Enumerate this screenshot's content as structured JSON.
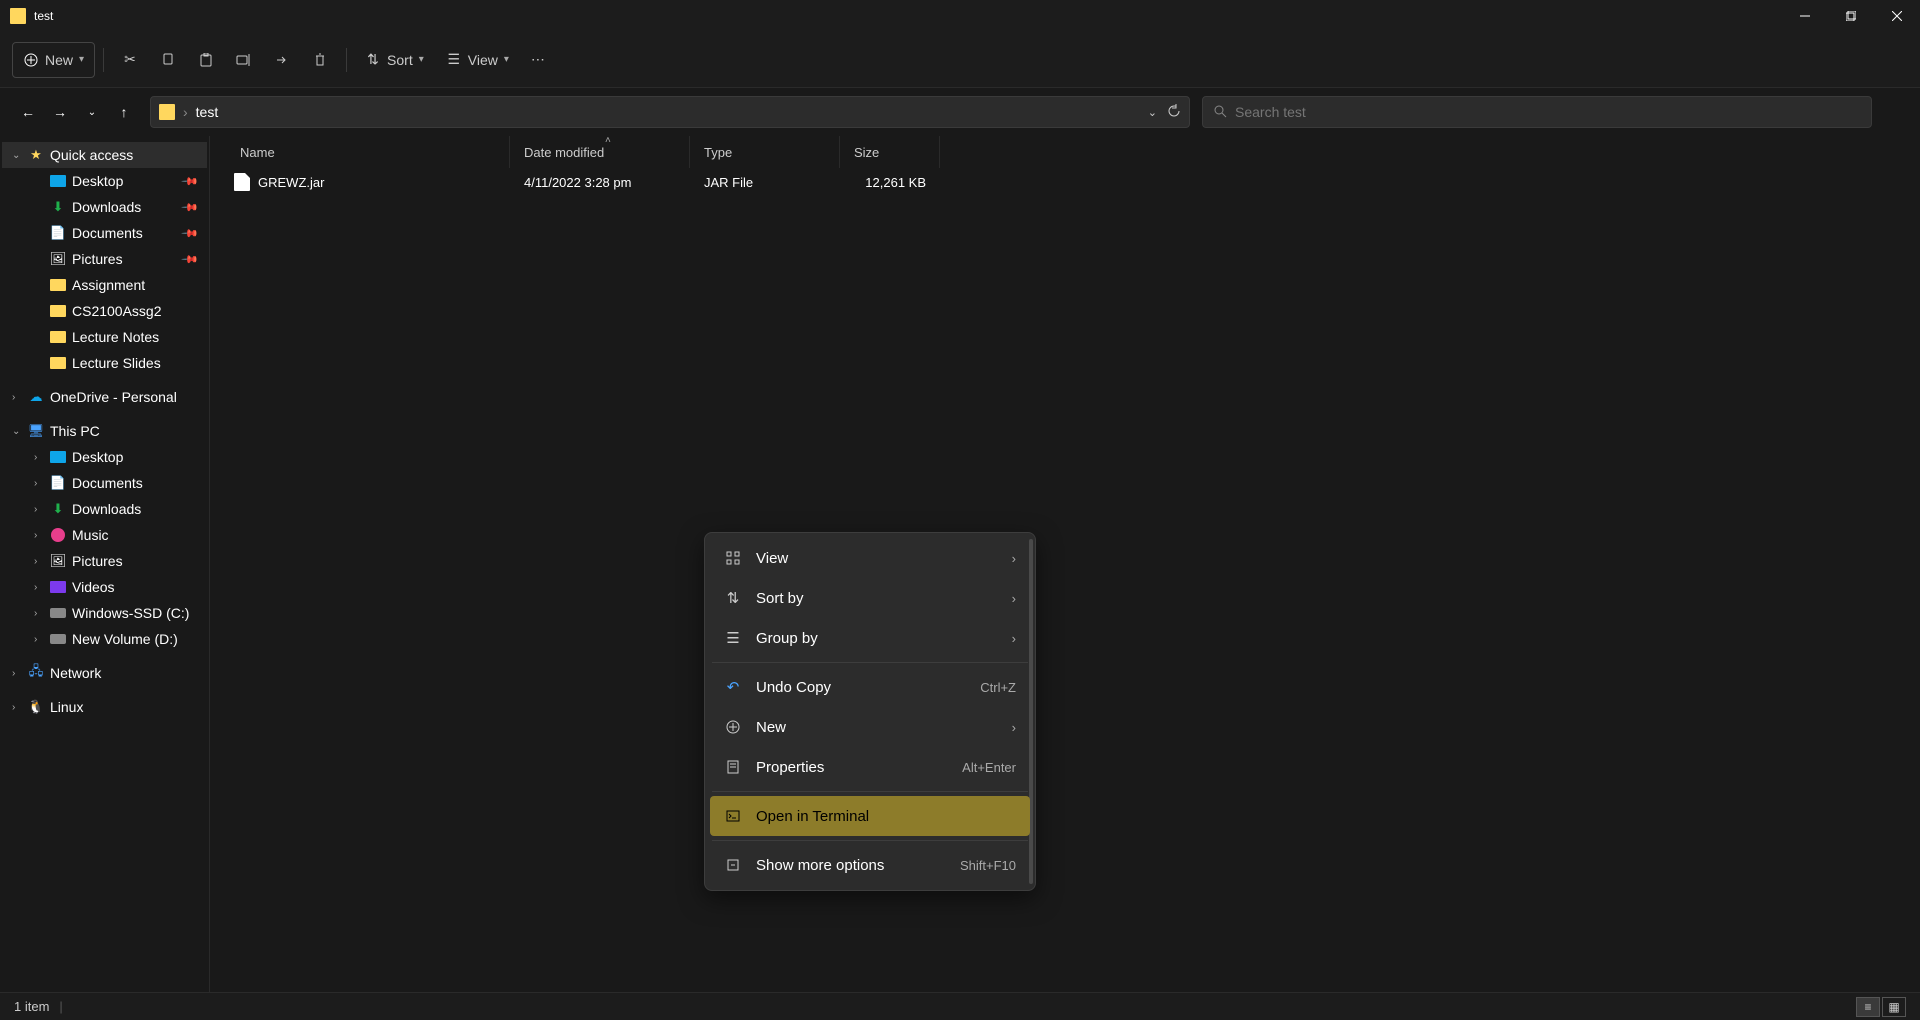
{
  "window": {
    "title": "test"
  },
  "toolbar": {
    "new_label": "New",
    "sort_label": "Sort",
    "view_label": "View"
  },
  "breadcrumb": {
    "current": "test"
  },
  "search": {
    "placeholder": "Search test"
  },
  "sidebar": {
    "quick_access": "Quick access",
    "qa_items": [
      {
        "label": "Desktop",
        "pinned": true
      },
      {
        "label": "Downloads",
        "pinned": true
      },
      {
        "label": "Documents",
        "pinned": true
      },
      {
        "label": "Pictures",
        "pinned": true
      },
      {
        "label": "Assignment",
        "pinned": false
      },
      {
        "label": "CS2100Assg2",
        "pinned": false
      },
      {
        "label": "Lecture Notes",
        "pinned": false
      },
      {
        "label": "Lecture Slides",
        "pinned": false
      }
    ],
    "onedrive": "OneDrive - Personal",
    "this_pc": "This PC",
    "pc_items": [
      {
        "label": "Desktop"
      },
      {
        "label": "Documents"
      },
      {
        "label": "Downloads"
      },
      {
        "label": "Music"
      },
      {
        "label": "Pictures"
      },
      {
        "label": "Videos"
      },
      {
        "label": "Windows-SSD (C:)"
      },
      {
        "label": "New Volume (D:)"
      }
    ],
    "network": "Network",
    "linux": "Linux"
  },
  "columns": {
    "name": "Name",
    "date": "Date modified",
    "type": "Type",
    "size": "Size"
  },
  "files": [
    {
      "name": "GREWZ.jar",
      "date": "4/11/2022 3:28 pm",
      "type": "JAR File",
      "size": "12,261 KB"
    }
  ],
  "context_menu": {
    "view": "View",
    "sort_by": "Sort by",
    "group_by": "Group by",
    "undo_copy": "Undo Copy",
    "undo_shortcut": "Ctrl+Z",
    "new": "New",
    "properties": "Properties",
    "properties_shortcut": "Alt+Enter",
    "open_terminal": "Open in Terminal",
    "show_more": "Show more options",
    "show_more_shortcut": "Shift+F10"
  },
  "status": {
    "item_count": "1 item"
  }
}
